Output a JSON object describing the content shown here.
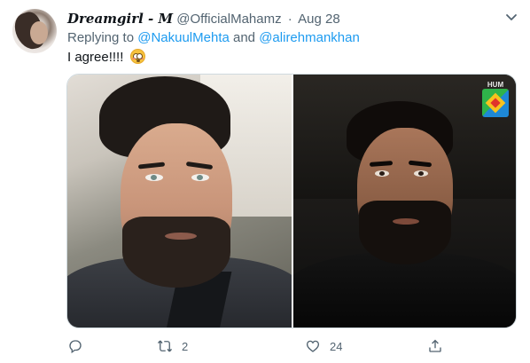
{
  "tweet": {
    "display_name": "Dreamgirl - M",
    "handle": "@OfficialMahamz",
    "separator": "·",
    "date": "Aug 28",
    "replying_to_prefix": "Replying to",
    "replying_mentions": [
      "@NakuulMehta",
      "@alirehmankhan"
    ],
    "replying_joiner": "and",
    "text": "I agree!!!!",
    "emoji": "flushed-face-emoji"
  },
  "media": {
    "images": [
      {
        "name": "left-photo",
        "description_icon": "portrait"
      },
      {
        "name": "right-photo",
        "description_icon": "portrait"
      }
    ],
    "channel_logo_text": "HUM"
  },
  "actions": {
    "reply_count": "",
    "retweet_count": "2",
    "like_count": "24",
    "share_count": ""
  },
  "colors": {
    "accent": "#1d9bf0",
    "secondary_text": "#536471",
    "primary_text": "#0f1419",
    "border": "#cfd9de"
  }
}
